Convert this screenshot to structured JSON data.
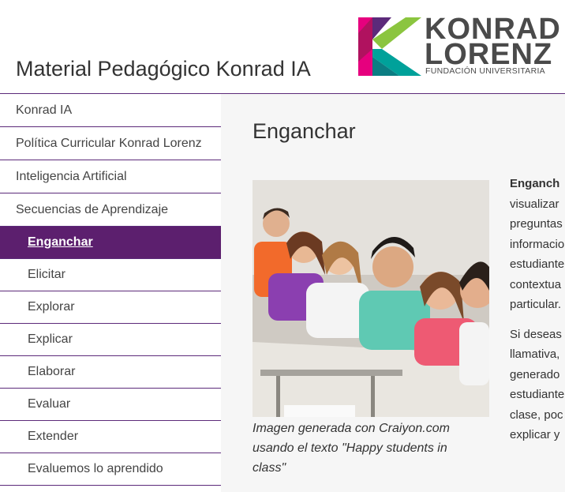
{
  "site": {
    "title": "Material Pedagógico Konrad IA",
    "logo": {
      "line1": "KONRAD",
      "line2": "LORENZ",
      "subtitle": "FUNDACIÓN UNIVERSITARIA",
      "colors": [
        "#e6007e",
        "#8bc53f",
        "#00a19a",
        "#5c2a7a"
      ]
    }
  },
  "sidebar": {
    "items": [
      {
        "label": "Konrad IA",
        "level": 0,
        "active": false
      },
      {
        "label": "Política Curricular Konrad Lorenz",
        "level": 0,
        "active": false
      },
      {
        "label": "Inteligencia Artificial",
        "level": 0,
        "active": false
      },
      {
        "label": "Secuencias de Aprendizaje",
        "level": 0,
        "active": false
      },
      {
        "label": "Enganchar",
        "level": 1,
        "active": true
      },
      {
        "label": "Elicitar",
        "level": 1,
        "active": false
      },
      {
        "label": "Explorar",
        "level": 1,
        "active": false
      },
      {
        "label": "Explicar",
        "level": 1,
        "active": false
      },
      {
        "label": "Elaborar",
        "level": 1,
        "active": false
      },
      {
        "label": "Evaluar",
        "level": 1,
        "active": false
      },
      {
        "label": "Extender",
        "level": 1,
        "active": false
      },
      {
        "label": "Evaluemos lo aprendido",
        "level": 1,
        "active": false
      }
    ]
  },
  "main": {
    "title": "Enganchar",
    "image_caption": "Imagen generada con Craiyon.com usando el texto \"Happy students in class\"",
    "side_text": {
      "para1": [
        "Enganch",
        "visualizar",
        "preguntas",
        "informacio",
        "estudiante",
        "contextua",
        "particular."
      ],
      "para2": [
        "Si deseas",
        "llamativa,",
        "generado",
        "estudiante",
        "clase, poc",
        "explicar y"
      ]
    }
  },
  "colors": {
    "accent": "#5c1f6e",
    "divider": "#5c2a7a"
  }
}
